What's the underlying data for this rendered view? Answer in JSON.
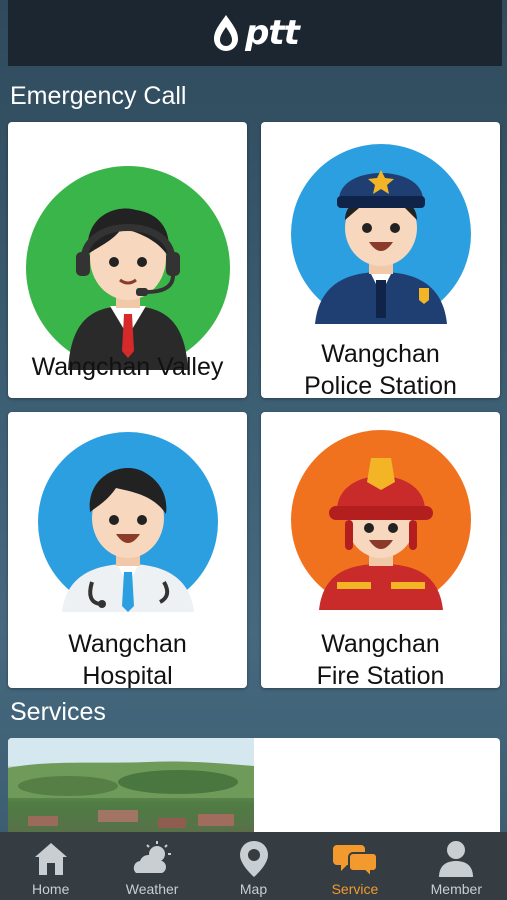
{
  "header": {
    "logo_text": "ptt",
    "logo_icon": "ptt-flame-logo"
  },
  "emergency": {
    "title": "Emergency Call",
    "cards": [
      {
        "label": "Wangchan Valley",
        "icon": "call-center-operator-avatar",
        "circle_color": "#3ab54a"
      },
      {
        "label": "Wangchan\nPolice Station",
        "icon": "police-officer-avatar",
        "circle_color": "#2b9fe0"
      },
      {
        "label": "Wangchan\nHospital",
        "icon": "doctor-avatar",
        "circle_color": "#2b9fe0"
      },
      {
        "label": "Wangchan\nFire Station",
        "icon": "firefighter-avatar",
        "circle_color": "#f0721e"
      }
    ]
  },
  "services": {
    "title": "Services"
  },
  "tabbar": {
    "active": "Service",
    "tabs": [
      {
        "label": "Home",
        "icon": "home-icon"
      },
      {
        "label": "Weather",
        "icon": "weather-icon"
      },
      {
        "label": "Map",
        "icon": "map-pin-icon"
      },
      {
        "label": "Service",
        "icon": "chat-bubbles-icon"
      },
      {
        "label": "Member",
        "icon": "person-icon"
      }
    ]
  },
  "colors": {
    "accent": "#f29a2e",
    "header_bg": "#1c2630",
    "tabbar_bg": "#353c42"
  }
}
